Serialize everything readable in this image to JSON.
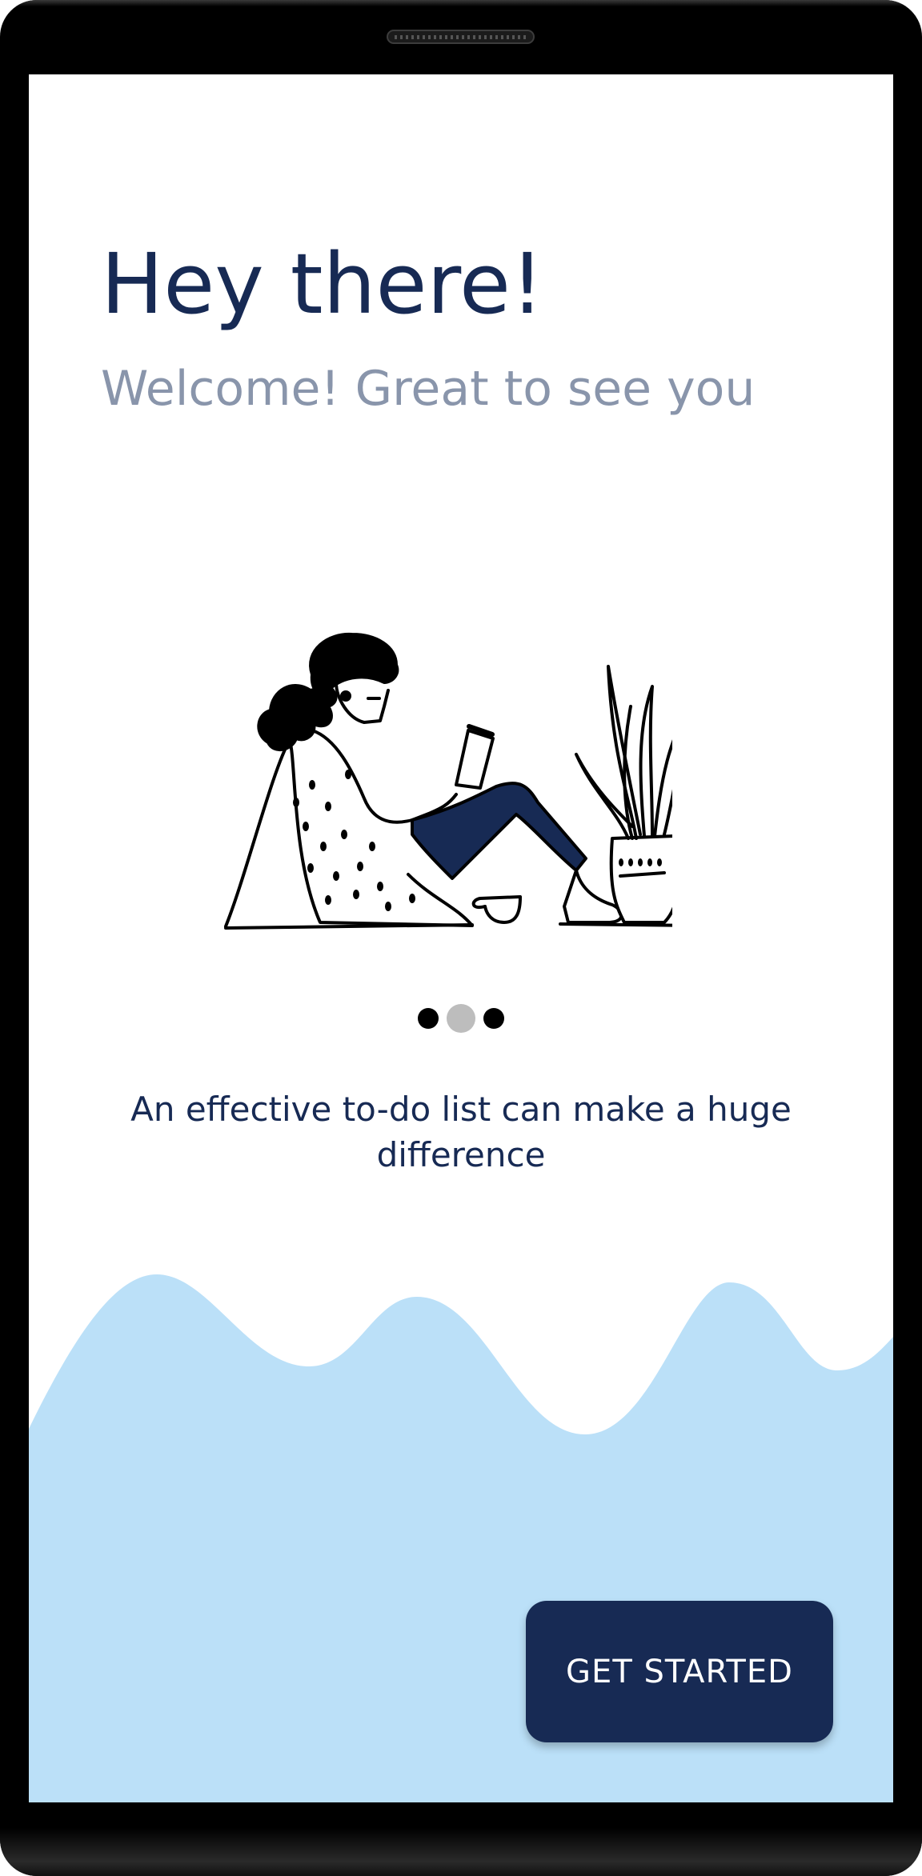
{
  "onboarding": {
    "title": "Hey there!",
    "subtitle": "Welcome! Great to see you",
    "tagline": "An effective to-do list can make a huge difference",
    "cta_label": "GET STARTED",
    "pager": {
      "page_count": 3,
      "active_index": 1
    },
    "illustration": "woman-reading-with-plant-icon"
  },
  "theme": {
    "primary_navy": "#172a54",
    "subtitle_gray": "#8995ab",
    "wave_blue": "#bbe0f8",
    "dot_inactive": "#000000",
    "dot_active": "#bdbdbd"
  }
}
